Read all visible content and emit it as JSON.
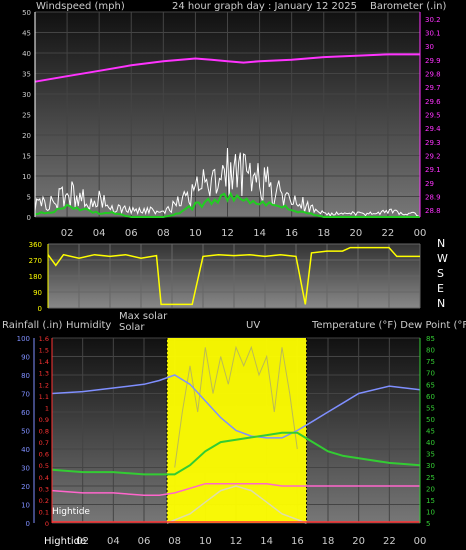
{
  "header": {
    "windspeed_label": "Windspeed (mph)",
    "title": "24 hour graph day : January 12 2025",
    "barometer_label": "Barometer (.in)"
  },
  "bottom_header": {
    "rainfall_label": "Rainfall (.in)",
    "humidity_label": "Humidity",
    "max_solar_label": "Max solar",
    "solar_label": "Solar",
    "uv_label": "UV",
    "temp_label": "Temperature (°F) Dew Point (°F)"
  },
  "hightide_label": "Hightide",
  "hightide_bottom_label": "Hightide",
  "direction_labels": [
    "N",
    "W",
    "S",
    "E",
    "N"
  ],
  "colors": {
    "barometer": "#ff33ff",
    "wind_gust": "#ffffff",
    "wind_avg": "#22cc22",
    "direction": "#ffff00",
    "solar": "#ffff00",
    "temperature": "#33cc33",
    "dew_point": "#7f8fff",
    "humidity": "#7f8fff",
    "uv": "#ffaaaa",
    "max_solar": "#ff66cc",
    "rainfall": "#ff3333"
  },
  "chart_data": [
    {
      "type": "line",
      "title": "24 hour graph day : January 12 2025",
      "x_ticks": [
        "02",
        "04",
        "06",
        "08",
        "10",
        "12",
        "14",
        "16",
        "18",
        "20",
        "22",
        "00"
      ],
      "y_left_label": "Windspeed (mph)",
      "y_left_ticks": [
        "0",
        "5",
        "10",
        "15",
        "20",
        "25",
        "30",
        "35",
        "40",
        "45",
        "50"
      ],
      "y_left_lim": [
        0,
        50
      ],
      "y_right_label": "Barometer (.in)",
      "y_right_ticks": [
        "28.8",
        "28.9",
        "29",
        "29.1",
        "29.2",
        "29.3",
        "29.4",
        "29.5",
        "29.6",
        "29.7",
        "29.8",
        "29.9",
        "30",
        "30.1",
        "30.2"
      ],
      "y_right_lim": [
        28.75,
        30.25
      ],
      "series": [
        {
          "axis": "right",
          "x": [
            0,
            2,
            4,
            6,
            8,
            10,
            11,
            12,
            13,
            14,
            16,
            18,
            20,
            22,
            24
          ],
          "values": [
            29.74,
            29.78,
            29.82,
            29.86,
            29.89,
            29.91,
            29.9,
            29.89,
            29.88,
            29.89,
            29.9,
            29.92,
            29.93,
            29.94,
            29.94
          ]
        },
        {
          "axis": "left",
          "x": [
            0,
            1,
            2,
            3,
            4,
            5,
            6,
            7,
            8,
            9,
            10,
            11,
            12,
            13,
            14,
            15,
            16,
            17,
            18,
            19,
            20,
            21,
            22,
            23,
            24
          ],
          "values": [
            5,
            4,
            7,
            6,
            5,
            3,
            2,
            2,
            2,
            5,
            8,
            10,
            14,
            12,
            10,
            9,
            6,
            3,
            1,
            1,
            1,
            1,
            2,
            1,
            1
          ]
        },
        {
          "axis": "left",
          "x": [
            0,
            1,
            2,
            3,
            4,
            5,
            6,
            7,
            8,
            9,
            10,
            11,
            12,
            13,
            14,
            15,
            16,
            17,
            18,
            19,
            20,
            21,
            22,
            23,
            24
          ],
          "values": [
            1,
            1,
            3,
            2,
            1,
            1,
            0,
            0,
            0,
            1,
            3,
            4,
            5,
            4,
            4,
            3,
            2,
            1,
            0,
            0,
            0,
            0,
            0,
            0,
            0
          ]
        }
      ]
    },
    {
      "type": "line",
      "x_ticks": [
        "02",
        "04",
        "06",
        "08",
        "10",
        "12",
        "14",
        "16",
        "18",
        "20",
        "22",
        "00"
      ],
      "y_ticks": [
        "0",
        "90",
        "180",
        "270",
        "360"
      ],
      "ylim": [
        0,
        360
      ],
      "series": [
        {
          "x": [
            0,
            0.5,
            1,
            2,
            3,
            4,
            5,
            6,
            7,
            7.3,
            9.3,
            10,
            11,
            12,
            13,
            14,
            15,
            16,
            16.6,
            17,
            18,
            19,
            19.5,
            20,
            21,
            22,
            22.5,
            24
          ],
          "values": [
            300,
            240,
            300,
            280,
            300,
            290,
            300,
            280,
            295,
            20,
            20,
            290,
            300,
            295,
            300,
            290,
            300,
            290,
            20,
            310,
            320,
            320,
            340,
            340,
            340,
            340,
            290,
            290
          ]
        }
      ]
    },
    {
      "type": "line",
      "x_ticks": [
        "02",
        "04",
        "06",
        "08",
        "10",
        "12",
        "14",
        "16",
        "18",
        "20",
        "22",
        "00"
      ],
      "y_left_ticks": [
        "0",
        "10",
        "20",
        "30",
        "40",
        "50",
        "60",
        "70",
        "80",
        "90",
        "100"
      ],
      "y_left_lim": [
        0,
        100
      ],
      "y_rain_ticks": [
        "0",
        "0.1",
        "0.2",
        "0.3",
        "0.4",
        "0.5",
        "0.6",
        "0.7",
        "0.8",
        "0.9",
        "1",
        "1.1",
        "1.2",
        "1.3",
        "1.4",
        "1.5",
        "1.6"
      ],
      "y_right_ticks": [
        "5",
        "10",
        "15",
        "20",
        "25",
        "30",
        "35",
        "40",
        "45",
        "50",
        "55",
        "60",
        "65",
        "70",
        "75",
        "80",
        "85"
      ],
      "y_right_lim": [
        5,
        85
      ],
      "solar_band": {
        "start": 7.5,
        "end": 16.6
      },
      "series": [
        {
          "name": "Humidity",
          "x": [
            0,
            2,
            4,
            6,
            7,
            8,
            9,
            10,
            11,
            12,
            13,
            14,
            15,
            16,
            17,
            18,
            19,
            20,
            22,
            24
          ],
          "values": [
            70,
            71,
            73,
            75,
            77,
            80,
            75,
            66,
            57,
            50,
            47,
            46,
            46,
            50,
            55,
            60,
            65,
            70,
            74,
            72
          ]
        },
        {
          "name": "Temperature",
          "x": [
            0,
            2,
            4,
            6,
            7,
            8,
            9,
            10,
            11,
            12,
            13,
            14,
            15,
            16,
            17,
            18,
            19,
            20,
            22,
            24
          ],
          "values": [
            28,
            27,
            27,
            26,
            26,
            26,
            30,
            36,
            40,
            41,
            42,
            43,
            44,
            44,
            40,
            36,
            34,
            33,
            31,
            30
          ]
        },
        {
          "name": "Dew Point",
          "x": [
            0,
            2,
            4,
            6,
            7,
            8,
            9,
            10,
            11,
            12,
            13,
            14,
            15,
            16,
            17,
            18,
            19,
            20,
            22,
            24
          ],
          "values": [
            19,
            18,
            18,
            17,
            17,
            18,
            20,
            22,
            22,
            22,
            22,
            22,
            21,
            21,
            21,
            21,
            21,
            21,
            21,
            21
          ]
        },
        {
          "name": "Max solar",
          "x": [
            7.5,
            9,
            10,
            11,
            12,
            13,
            14,
            15,
            16.6
          ],
          "values": [
            5,
            9,
            14,
            19,
            21,
            19,
            14,
            9,
            5
          ]
        },
        {
          "name": "Solar",
          "x": [
            8,
            8.5,
            9,
            9.5,
            10,
            10.5,
            11,
            11.5,
            12,
            12.5,
            13,
            13.5,
            14,
            14.5,
            15,
            15.5,
            16
          ],
          "values": [
            30,
            60,
            85,
            60,
            95,
            70,
            90,
            75,
            95,
            85,
            95,
            80,
            90,
            60,
            95,
            70,
            40
          ]
        }
      ]
    }
  ]
}
